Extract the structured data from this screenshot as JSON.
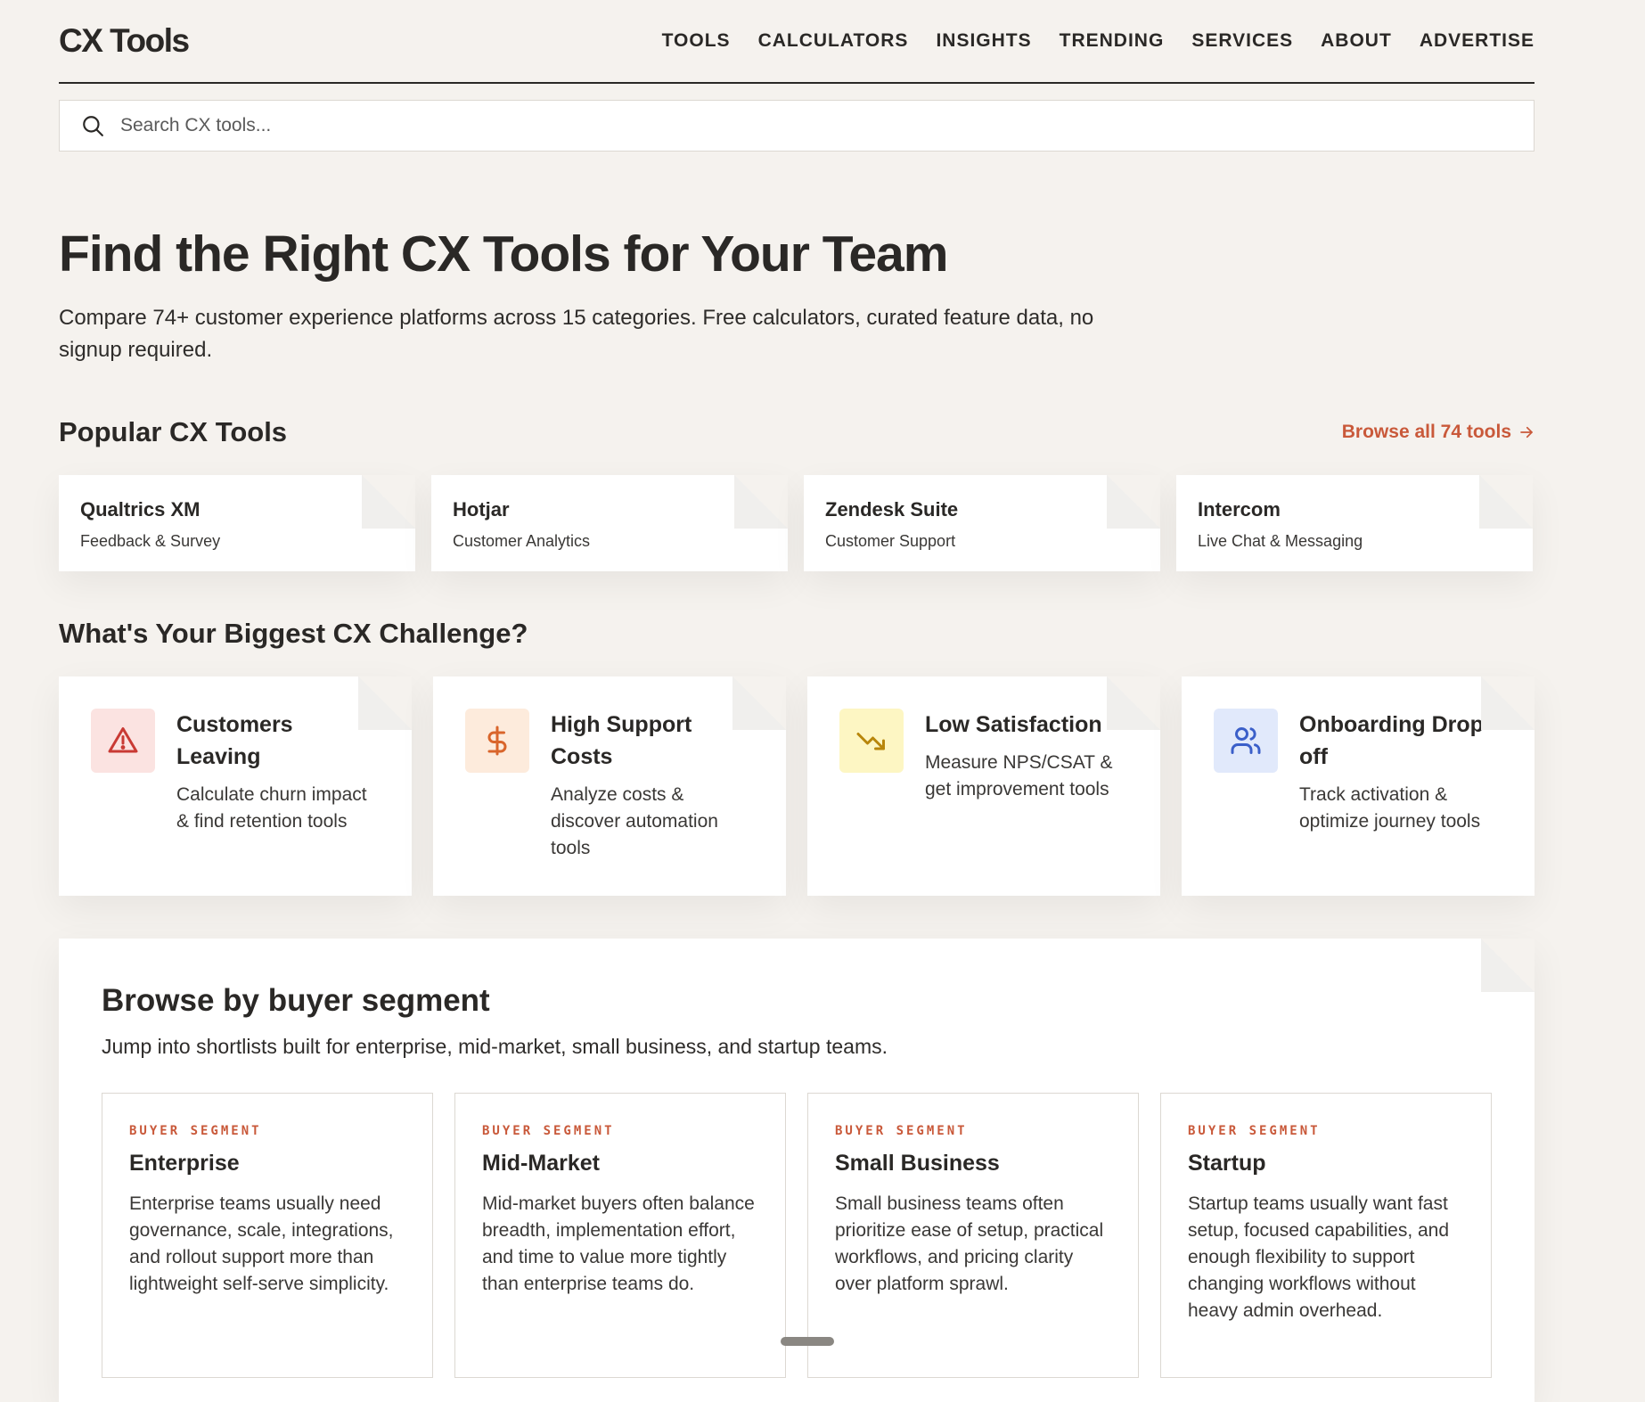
{
  "header": {
    "logo": "CX Tools",
    "nav": [
      "TOOLS",
      "CALCULATORS",
      "INSIGHTS",
      "TRENDING",
      "SERVICES",
      "ABOUT",
      "ADVERTISE"
    ]
  },
  "search": {
    "placeholder": "Search CX tools..."
  },
  "hero": {
    "title": "Find the Right CX Tools for Your Team",
    "subtitle": "Compare 74+ customer experience platforms across 15 categories. Free calculators, curated feature data, no signup required."
  },
  "popular": {
    "title": "Popular CX Tools",
    "browse_label": "Browse all 74 tools",
    "tools": [
      {
        "name": "Qualtrics XM",
        "category": "Feedback & Survey"
      },
      {
        "name": "Hotjar",
        "category": "Customer Analytics"
      },
      {
        "name": "Zendesk Suite",
        "category": "Customer Support"
      },
      {
        "name": "Intercom",
        "category": "Live Chat & Messaging"
      }
    ]
  },
  "challenges": {
    "title": "What's Your Biggest CX Challenge?",
    "items": [
      {
        "title": "Customers Leaving",
        "desc": "Calculate churn impact & find retention tools",
        "icon": "alert-triangle-icon",
        "bg": "#fbe3e1",
        "fg": "#c93a34"
      },
      {
        "title": "High Support Costs",
        "desc": "Analyze costs & discover automation tools",
        "icon": "dollar-icon",
        "bg": "#fdebdc",
        "fg": "#d9652b"
      },
      {
        "title": "Low Satisfaction",
        "desc": "Measure NPS/CSAT & get improvement tools",
        "icon": "trending-down-icon",
        "bg": "#fdf6c3",
        "fg": "#b8860b"
      },
      {
        "title": "Onboarding Drop-off",
        "desc": "Track activation & optimize journey tools",
        "icon": "users-icon",
        "bg": "#e1e9fb",
        "fg": "#3b5fc9"
      }
    ]
  },
  "segments": {
    "title": "Browse by buyer segment",
    "subtitle": "Jump into shortlists built for enterprise, mid-market, small business, and startup teams.",
    "items": [
      {
        "label": "BUYER SEGMENT",
        "title": "Enterprise",
        "desc": "Enterprise teams usually need governance, scale, integrations, and rollout support more than lightweight self-serve simplicity."
      },
      {
        "label": "BUYER SEGMENT",
        "title": "Mid-Market",
        "desc": "Mid-market buyers often balance breadth, implementation effort, and time to value more tightly than enterprise teams do."
      },
      {
        "label": "BUYER SEGMENT",
        "title": "Small Business",
        "desc": "Small business teams often prioritize ease of setup, practical workflows, and pricing clarity over platform sprawl."
      },
      {
        "label": "BUYER SEGMENT",
        "title": "Startup",
        "desc": "Startup teams usually want fast setup, focused capabilities, and enough flexibility to support changing workflows without heavy admin overhead."
      }
    ]
  }
}
